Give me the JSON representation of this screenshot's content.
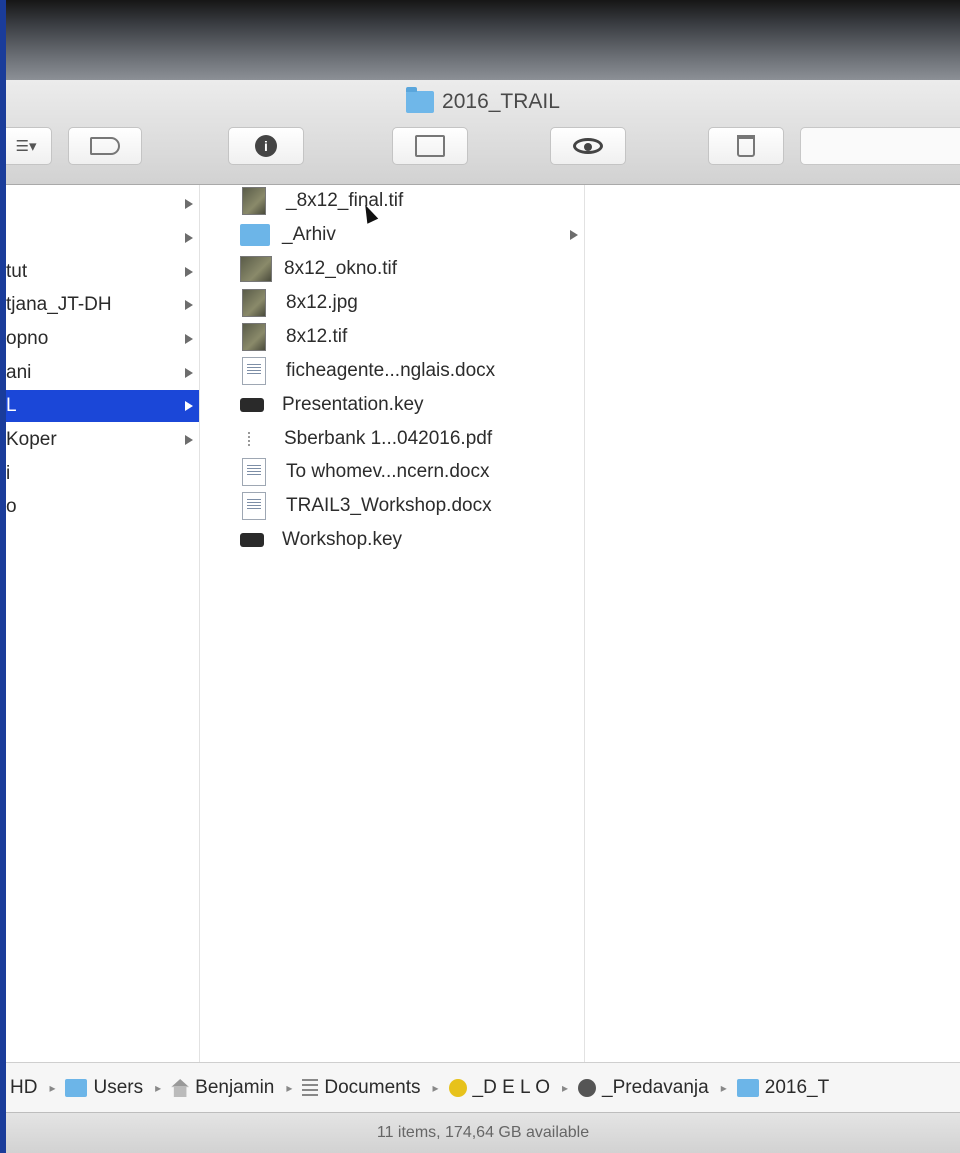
{
  "window": {
    "title": "2016_TRAIL"
  },
  "toolbar": {
    "view_icon": "list-view-icon",
    "tag_icon": "tag-icon",
    "info_icon": "info-icon",
    "new_folder_icon": "new-folder-icon",
    "quicklook_icon": "eye-icon",
    "trash_icon": "trash-icon"
  },
  "column1": {
    "items": [
      {
        "label": "",
        "has_children": true
      },
      {
        "label": "",
        "has_children": true
      },
      {
        "label": "tut",
        "has_children": true
      },
      {
        "label": "tjana_JT-DH",
        "has_children": true
      },
      {
        "label": "opno",
        "has_children": true
      },
      {
        "label": "ani",
        "has_children": true
      },
      {
        "label": "L",
        "has_children": true,
        "selected": true
      },
      {
        "label": "Koper",
        "has_children": true
      },
      {
        "label": "i",
        "has_children": false
      },
      {
        "label": "o",
        "has_children": false
      }
    ]
  },
  "column2": {
    "items": [
      {
        "label": "_8x12_final.tif",
        "icon": "image-icon",
        "kind": "img",
        "has_children": false
      },
      {
        "label": "_Arhiv",
        "icon": "folder-icon",
        "kind": "folder",
        "has_children": true
      },
      {
        "label": "8x12_okno.tif",
        "icon": "image-icon",
        "kind": "img-wide",
        "has_children": false
      },
      {
        "label": "8x12.jpg",
        "icon": "image-icon",
        "kind": "img",
        "has_children": false
      },
      {
        "label": "8x12.tif",
        "icon": "image-icon",
        "kind": "img",
        "has_children": false
      },
      {
        "label": "ficheagente...nglais.docx",
        "icon": "document-icon",
        "kind": "doc",
        "has_children": false
      },
      {
        "label": "Presentation.key",
        "icon": "keynote-icon",
        "kind": "key",
        "has_children": false
      },
      {
        "label": "Sberbank 1...042016.pdf",
        "icon": "pdf-icon",
        "kind": "pdf",
        "has_children": false
      },
      {
        "label": "To whomev...ncern.docx",
        "icon": "document-icon",
        "kind": "doc",
        "has_children": false
      },
      {
        "label": "TRAIL3_Workshop.docx",
        "icon": "document-icon",
        "kind": "doc",
        "has_children": false
      },
      {
        "label": "Workshop.key",
        "icon": "keynote-icon",
        "kind": "key",
        "has_children": false
      }
    ]
  },
  "pathbar": {
    "crumbs": [
      {
        "label": "HD",
        "icon": "disk-icon"
      },
      {
        "label": "Users",
        "icon": "folder-icon"
      },
      {
        "label": "Benjamin",
        "icon": "home-icon"
      },
      {
        "label": "Documents",
        "icon": "documents-icon"
      },
      {
        "label": "_D E L O",
        "icon": "yellow-folder-icon"
      },
      {
        "label": "_Predavanja",
        "icon": "gear-folder-icon"
      },
      {
        "label": "2016_T",
        "icon": "folder-icon"
      }
    ]
  },
  "status": {
    "text": "11 items, 174,64 GB available"
  }
}
